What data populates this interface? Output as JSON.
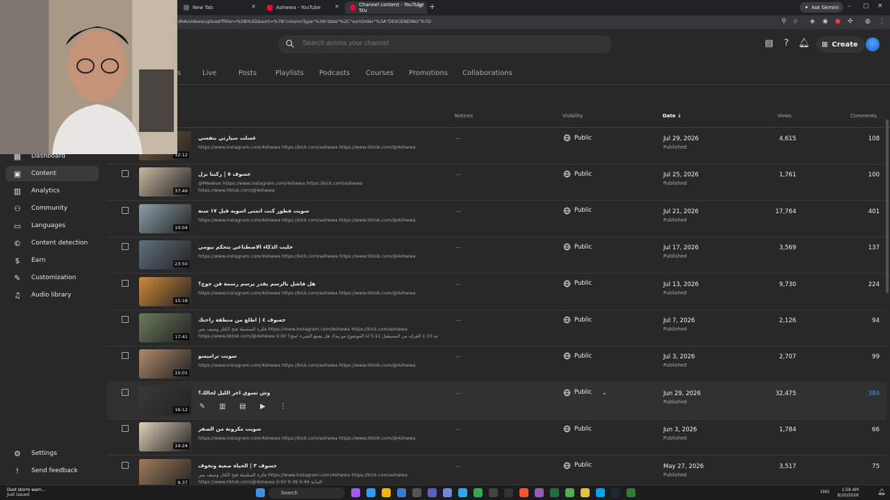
{
  "browser": {
    "tabs": [
      {
        "label": "New Tab"
      },
      {
        "label": "Ashwwa - YouTube"
      },
      {
        "label": "Channel content - YouTube Stu"
      }
    ],
    "gemini_label": "Ask Gemini",
    "url": "dhA/videos/upload?filter=%5B%5D&sort=%7B\"columnType\"%3A\"date\"%2C\"sortOrder\"%3A\"DESCENDING\"%7D"
  },
  "studio": {
    "search_placeholder": "Search across your channel",
    "create_label": "Create",
    "content_tabs": [
      "s",
      "Live",
      "Posts",
      "Playlists",
      "Podcasts",
      "Courses",
      "Promotions",
      "Collaborations"
    ],
    "columns": {
      "notices": "Notices",
      "visibility": "Visibility",
      "date": "Date",
      "views": "Views",
      "comments": "Comments"
    },
    "sidebar": [
      {
        "label": "Dashboard",
        "icon": "dashboard-icon"
      },
      {
        "label": "Content",
        "icon": "content-icon"
      },
      {
        "label": "Analytics",
        "icon": "analytics-icon"
      },
      {
        "label": "Community",
        "icon": "community-icon"
      },
      {
        "label": "Languages",
        "icon": "languages-icon"
      },
      {
        "label": "Content detection",
        "icon": "copyright-icon"
      },
      {
        "label": "Earn",
        "icon": "earn-icon"
      },
      {
        "label": "Customization",
        "icon": "customization-icon"
      },
      {
        "label": "Audio library",
        "icon": "audio-library-icon"
      }
    ],
    "sidebar_bottom": [
      {
        "label": "Settings",
        "icon": "settings-icon"
      },
      {
        "label": "Send feedback",
        "icon": "feedback-icon"
      }
    ],
    "videos": [
      {
        "title": "غسلت سيارتي بنفسي",
        "desc1": "https://www.instagram.com/4shwwa https://kick.com/ashwwa https://www.tiktok.com/@4shwwa",
        "desc2": "",
        "duration": "12:12",
        "notice": "—",
        "visibility": "Public",
        "date": "Jul 29, 2026",
        "status": "Published",
        "views": "4,615",
        "comments": "108"
      },
      {
        "title": "خسوف ٥ | ركبنا بزل",
        "desc1": "@Mleekan https://www.instagram.com/4shwwa https://kick.com/ashwwa",
        "desc2": "https://www.tiktok.com/@4shwwa",
        "duration": "37:49",
        "notice": "—",
        "visibility": "Public",
        "date": "Jul 25, 2026",
        "status": "Published",
        "views": "1,761",
        "comments": "100"
      },
      {
        "title": "سويت فطور كنت اتمنى اسويه قبل ١٧ سنة",
        "desc1": "https://www.instagram.com/4shwwa https://kick.com/ashwwa https://www.tiktok.com/@4shwwa",
        "desc2": "",
        "duration": "10:04",
        "notice": "—",
        "visibility": "Public",
        "date": "Jul 21, 2026",
        "status": "Published",
        "views": "17,764",
        "comments": "401"
      },
      {
        "title": "خليت الذكاء الاصطناعي يتحكم بيومي",
        "desc1": "https://www.instagram.com/4shwwa https://kick.com/ashwwa https://www.tiktok.com/@4shwwa",
        "desc2": "",
        "duration": "23:50",
        "notice": "—",
        "visibility": "Public",
        "date": "Jul 17, 2026",
        "status": "Published",
        "views": "3,569",
        "comments": "137"
      },
      {
        "title": "هل فاشل بالرسم يقدر يرسم رسمة فن جوج؟",
        "desc1": "https://www.instagram.com/4shwwa https://kick.com/ashwwa https://www.tiktok.com/@4shwwa",
        "desc2": "",
        "duration": "15:18",
        "notice": "—",
        "visibility": "Public",
        "date": "Jul 13, 2026",
        "status": "Published",
        "views": "9,730",
        "comments": "224"
      },
      {
        "title": "خسوف ٤ | اطلع من منطقة راحتك",
        "desc1": "فكرة السلسلة فتح الكثار وسيف بس https://www.instagram.com/4shwwa https://kick.com/ashwwa",
        "desc2": "https://www.tiktok.com/@4shwwa 0:00 البداية 1:10 الغرف من المستقبل 5:11 انا الموضوع مو بيدك هل يصنع الشيء امتح؟",
        "duration": "17:41",
        "notice": "—",
        "visibility": "Public",
        "date": "Jul 7, 2026",
        "status": "Published",
        "views": "2,126",
        "comments": "94"
      },
      {
        "title": "سويت تراميسو",
        "desc1": "https://www.instagram.com/4shwwa https://kick.com/ashwwa https://www.tiktok.com/@4shwwa",
        "desc2": "",
        "duration": "15:01",
        "notice": "—",
        "visibility": "Public",
        "date": "Jul 3, 2026",
        "status": "Published",
        "views": "2,707",
        "comments": "99"
      },
      {
        "title": "وش تسوي اخر الليل لحالك؟",
        "desc1": "",
        "desc2": "",
        "duration": "16:12",
        "notice": "—",
        "visibility": "Public",
        "date": "Jun 29, 2026",
        "status": "Published",
        "views": "32,475",
        "comments": "384"
      },
      {
        "title": "سويت مكرونة من الصفر",
        "desc1": "https://www.instagram.com/4shwwa https://kick.com/ashwwa https://www.tiktok.com/@4shwwa",
        "desc2": "",
        "duration": "14:24",
        "notice": "—",
        "visibility": "Public",
        "date": "Jun 3, 2026",
        "status": "Published",
        "views": "1,784",
        "comments": "66"
      },
      {
        "title": "خسوف ٣ | الحياة صعبة وتخوف",
        "desc1": "فكرة السلسلة فتح الكثار وسيف بس https://www.instagram.com/4shwwa https://kick.com/ashwwa",
        "desc2": "https://www.tiktok.com/@4shwwa 0:00 9:36 البداية 0:49",
        "duration": "9:37",
        "notice": "—",
        "visibility": "Public",
        "date": "May 27, 2026",
        "status": "Published",
        "views": "3,517",
        "comments": "75"
      }
    ]
  },
  "taskbar": {
    "weather_line1": "Dust storm warn...",
    "weather_line2": "Just issued",
    "search_label": "Search",
    "lang": "ENG",
    "time": "1:58 AM",
    "date": "8/20/2026"
  }
}
